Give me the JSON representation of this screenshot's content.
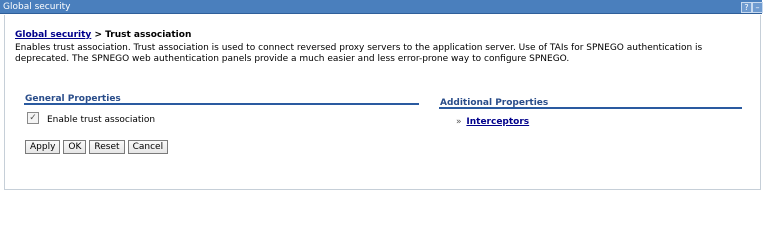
{
  "window": {
    "title": "Global security",
    "help_label": "?",
    "minimize_label": "–"
  },
  "breadcrumb": {
    "parent": "Global security",
    "separator": ">",
    "current": "Trust association"
  },
  "description": "Enables trust association. Trust association is used to connect reversed proxy servers to the application server. Use of TAIs for SPNEGO authentication is deprecated. The SPNEGO web authentication panels provide a much easier and less error-prone way to configure SPNEGO.",
  "general_properties": {
    "title": "General Properties",
    "enable_trust_association": {
      "label": "Enable trust association",
      "checked": true,
      "check_glyph": "✓"
    }
  },
  "additional_properties": {
    "title": "Additional Properties",
    "bullet": "»",
    "links": [
      {
        "label": "Interceptors"
      }
    ]
  },
  "buttons": {
    "apply": "Apply",
    "ok": "OK",
    "reset": "Reset",
    "cancel": "Cancel"
  }
}
